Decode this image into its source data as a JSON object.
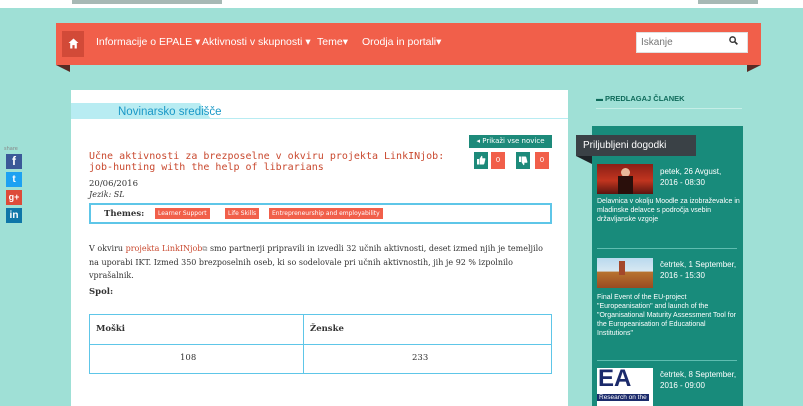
{
  "nav": {
    "home_icon": "home-icon",
    "items": [
      "Informacije o EPALE",
      "Aktivnosti v skupnosti",
      "Teme",
      "Orodja in portali"
    ],
    "search_placeholder": "Iskanje",
    "search_icon": "search-icon"
  },
  "main": {
    "section_label": "Novinarsko središče",
    "show_all_label": "Prikaži vse novice",
    "votes": {
      "likes": "0",
      "dislikes": "0"
    },
    "article": {
      "title": "Učne aktivnosti za brezposelne v okviru projekta LinkINjob: job-hunting with the help of librarians",
      "date": "20/06/2016",
      "language": "Jezik: SL",
      "themes_label": "Themes:",
      "themes": [
        "Learner Support",
        "Life Skills",
        "Entrepreneurship and employability"
      ],
      "body_prefix": "V okviru ",
      "body_link": "projekta LinkINjob",
      "body_suffix": " smo partnerji pripravili in izvedli 32 učnih aktivnosti, deset izmed njih je temeljilo na uporabi IKT. Izmed 350 brezposelnih oseb, ki so sodelovale pri učnih aktivnostih, jih je 92 % izpolnilo vprašalnik.",
      "spol_label": "Spol:",
      "table": {
        "headers": [
          "Moški",
          "Ženske"
        ],
        "values": [
          "108",
          "233"
        ]
      }
    }
  },
  "share": {
    "label": "share",
    "networks": [
      "f",
      "t",
      "g+",
      "in"
    ],
    "colors": [
      "#3b5998",
      "#1da1f2",
      "#dd4b39",
      "#0e76a8"
    ]
  },
  "sidebar": {
    "suggest_label": "PREDLAGAJ ČLANEK",
    "events_title": "Priljubljeni dogodki",
    "events": [
      {
        "date": "petek, 26 Avgust, 2016 - 08:30",
        "desc": "Delavnica v okolju Moodle za izobraževalce in mladinske delavce s področja vsebin državljanske vzgoje"
      },
      {
        "date": "četrtek, 1 September, 2016 - 15:30",
        "desc": "Final Event of the EU-project \"Europeanisation\" and launch of the \"Organisational Maturity Assessment Tool for the Europeanisation of Educational Institutions\""
      },
      {
        "date": "četrtek, 8 September, 2016 - 09:00",
        "desc": ""
      }
    ],
    "event3_thumb_text": "EA",
    "event3_thumb_sub": "Research on the"
  },
  "colors": {
    "background": "#9fe0d6",
    "nav": "#f15f4a",
    "accent_teal": "#188b7b",
    "link_blue": "#1a98c7",
    "title_red": "#c9492f"
  }
}
